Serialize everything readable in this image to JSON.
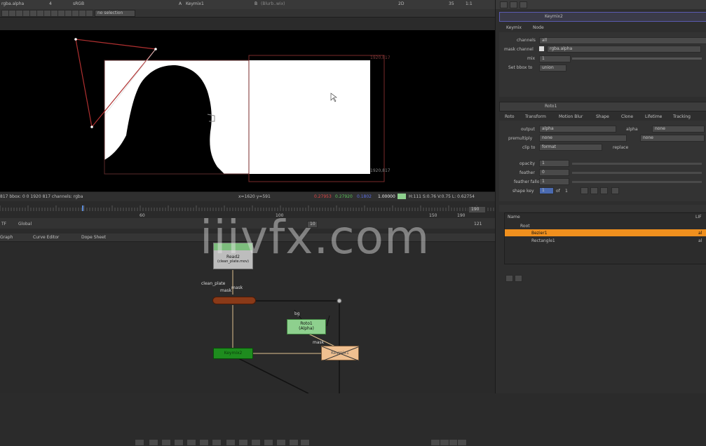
{
  "viewer_toolbar": {
    "channel_set": "rgba.alpha",
    "channel_count": "4",
    "colorspace": "sRGB",
    "input_a_label": "A",
    "input_a": "Keymix1",
    "input_b_label": "B",
    "input_b": "(Blurb..wix)",
    "zoom": "2D",
    "frame_x": "35",
    "ratio": "1:1",
    "roi_dropdown": "no selection"
  },
  "viewer_status": {
    "bbox": "817  bbox: 0 0 1920 817 channels: rgba",
    "cursor": "x=1620 y=591",
    "r_value": "0.27953",
    "g_value": "0.27920",
    "b_value": "0.1802",
    "a_value": "1.00000",
    "hsv": "H:111 S:0.76 V:0.75  L: 0.62754"
  },
  "viewer_overlay": {
    "format_label_top": "1920,817",
    "format_label_bottom": "1920,817"
  },
  "timeline": {
    "tick_1": "60",
    "tick_2": "100",
    "tick_3": "150",
    "tick_4": "190",
    "end_frame": "190",
    "fps_dropdown": "TF",
    "global_dropdown": "Global",
    "frame_step": "10",
    "current_frame": "121"
  },
  "node_graph": {
    "tabs": [
      "Graph",
      "Curve Editor",
      "Dope Sheet"
    ],
    "nodes": {
      "read_label": "Read2",
      "read_sub": "(clean_plate.mov)",
      "clean_plate": "clean_plate",
      "mask_label_1": "mask",
      "mask_label_2": "mask",
      "merge_label": "",
      "roto_label": "Roto1",
      "roto_sub": "(Alpha)",
      "bg_label": "bg",
      "keymix_label": "Keymix2",
      "disabled_label": "Keymix1"
    }
  },
  "watermark": "iiivfx.com",
  "properties_keymix": {
    "title": "Keymix2",
    "tabs": [
      "Keymix",
      "Node"
    ],
    "channels_label": "channels",
    "channels_value": "all",
    "mask_channel_label": "mask channel",
    "mask_channel_value": "rgba.alpha",
    "mix_label": "mix",
    "mix_value": "1",
    "set_bbox_label": "Set bbox to",
    "set_bbox_value": "union"
  },
  "properties_roto": {
    "title": "Roto1",
    "tabs": [
      "Roto",
      "Transform",
      "Motion Blur",
      "Shape",
      "Clone",
      "Lifetime",
      "Tracking"
    ],
    "output_label": "output",
    "output_value": "alpha",
    "output_extra": "alpha",
    "output_extra2": "none",
    "premultiply_label": "premultiply",
    "premultiply_value": "none",
    "premultiply_extra": "none",
    "clip_to_label": "clip to",
    "clip_to_value": "format",
    "replace_label": "replace",
    "opacity_label": "opacity",
    "opacity_value": "1",
    "feather_label": "feather",
    "feather_value": "0",
    "feather_falloff_label": "feather falloff",
    "feather_falloff_value": "1",
    "shape_key_label": "shape key",
    "shape_key_value": "1",
    "shape_key_of": "of",
    "shape_key_total": "1"
  },
  "curves_list": {
    "header": "Name",
    "root_label": "Root",
    "rows": [
      "Bezier1",
      "Rectangle1"
    ],
    "right_tag": "LIF",
    "row1_tag": "al",
    "row2_tag": "al"
  },
  "colors": {
    "accent_orange": "#f0901e",
    "viewer_bg": "#000000",
    "panel_bg": "#393939",
    "roto_node": "#8ed08e",
    "keymix_node": "#1e8c1e",
    "read_node": "#bcbcbc",
    "merge_node": "#8a3a18"
  }
}
